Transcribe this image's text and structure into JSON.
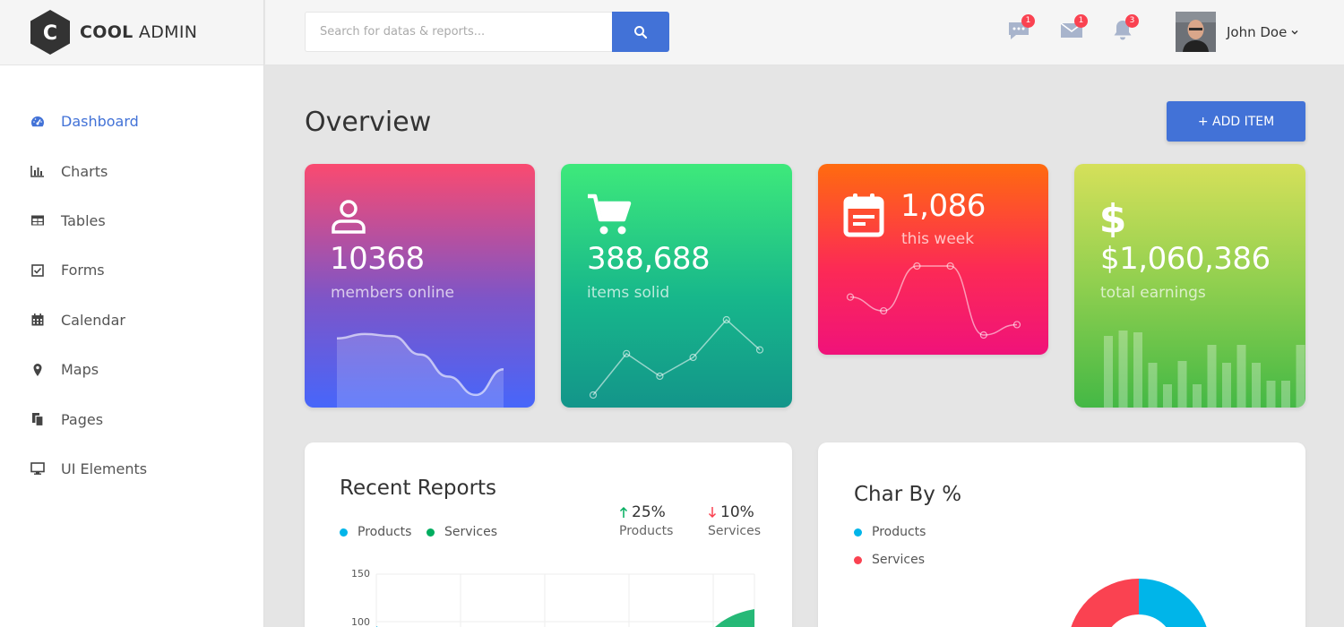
{
  "brand": {
    "name_bold": "COOL",
    "name_rest": "ADMIN",
    "mark_letter": "C"
  },
  "sidebar": {
    "items": [
      {
        "label": "Dashboard",
        "icon": "tachometer-icon",
        "active": true
      },
      {
        "label": "Charts",
        "icon": "bar-chart-icon",
        "active": false
      },
      {
        "label": "Tables",
        "icon": "table-icon",
        "active": false
      },
      {
        "label": "Forms",
        "icon": "checkbox-icon",
        "active": false
      },
      {
        "label": "Calendar",
        "icon": "calendar-icon",
        "active": false
      },
      {
        "label": "Maps",
        "icon": "map-marker-icon",
        "active": false
      },
      {
        "label": "Pages",
        "icon": "copy-icon",
        "active": false
      },
      {
        "label": "UI Elements",
        "icon": "desktop-icon",
        "active": false
      }
    ]
  },
  "header": {
    "search": {
      "placeholder": "Search for datas & reports...",
      "value": ""
    },
    "notifications": [
      {
        "icon": "comment-icon",
        "count": "1"
      },
      {
        "icon": "email-icon",
        "count": "1"
      },
      {
        "icon": "bell-icon",
        "count": "3"
      }
    ],
    "user": {
      "name": "John Doe"
    }
  },
  "main": {
    "title": "Overview",
    "add_button": "+ ADD ITEM",
    "cards": [
      {
        "value": "10368",
        "label": "members online",
        "icon": "user-icon",
        "trend": [
          0.82,
          0.88,
          0.85,
          0.6,
          0.3,
          0.05,
          0.4
        ]
      },
      {
        "value": "388,688",
        "label": "items solid",
        "icon": "cart-icon",
        "trend": [
          0.0,
          0.55,
          0.25,
          0.5,
          1.0,
          0.6
        ]
      },
      {
        "value": "1,086",
        "label": "this week",
        "icon": "calendar-icon",
        "trend": [
          0.55,
          0.35,
          1.0,
          1.0,
          0.0,
          0.15
        ]
      },
      {
        "value": "$1,060,386",
        "label": "total earnings",
        "icon": "dollar-icon",
        "bars": [
          0.8,
          0.86,
          0.84,
          0.5,
          0.26,
          0.52,
          0.26,
          0.7,
          0.5,
          0.7,
          0.5,
          0.3,
          0.3,
          0.7
        ]
      }
    ],
    "recent_reports": {
      "title": "Recent Reports",
      "legend": [
        {
          "label": "Products",
          "color": "#00b5e9"
        },
        {
          "label": "Services",
          "color": "#00ad5f"
        }
      ],
      "kpis": [
        {
          "value": "25%",
          "label": "Products",
          "direction": "up",
          "color": "#00ad5f"
        },
        {
          "value": "10%",
          "label": "Services",
          "direction": "down",
          "color": "#fa4251"
        }
      ],
      "y_ticks": [
        "150",
        "100"
      ]
    },
    "char_by": {
      "title": "Char By %",
      "legend": [
        {
          "label": "Products",
          "color": "#00b5e9"
        },
        {
          "label": "Services",
          "color": "#fa4251"
        }
      ]
    }
  },
  "colors": {
    "accent": "#4272d7",
    "badge": "#fa4251"
  }
}
